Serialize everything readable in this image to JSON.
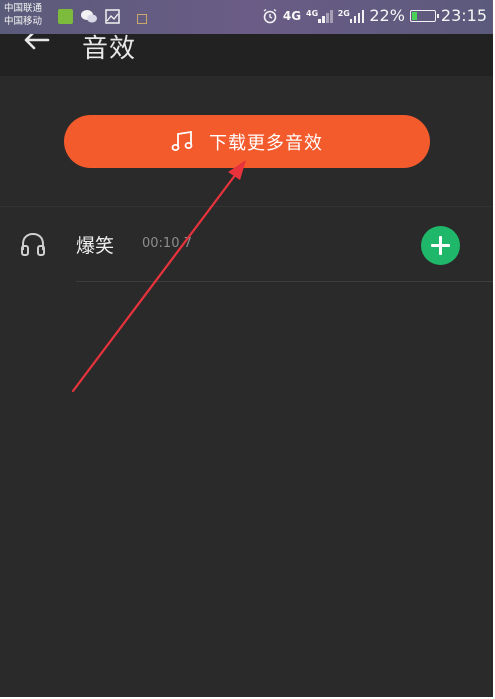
{
  "status_bar": {
    "carrier_1": "中国联通",
    "carrier_2": "中国移动",
    "network_1": "4G",
    "network_2": "4G",
    "network_3": "2G",
    "battery_percent": "22%",
    "battery_level": 0.22,
    "time": "23:15",
    "icons": [
      "app-notification-icon",
      "wechat-icon",
      "gallery-icon",
      "small-notification-icon",
      "alarm-icon",
      "signal-icon",
      "battery-icon"
    ]
  },
  "header": {
    "back_icon": "back-arrow-icon",
    "title": "音效"
  },
  "download": {
    "icon": "music-note-icon",
    "label": "下载更多音效"
  },
  "sound_list": [
    {
      "icon": "headphones-icon",
      "title": "爆笑",
      "duration": "00:10.7",
      "action_icon": "add-icon"
    }
  ],
  "colors": {
    "background": "#2a2a2a",
    "header_background": "#222222",
    "accent_orange": "#f35a2c",
    "add_green": "#1fb86a",
    "annotation_arrow": "#e8333c"
  }
}
